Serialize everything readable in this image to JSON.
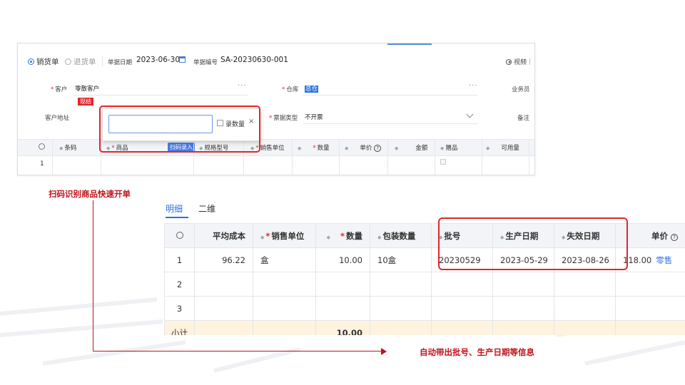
{
  "form": {
    "radio_sales": "销货单",
    "radio_return": "退货单",
    "doc_date_label": "单据日期",
    "doc_date": "2023-06-30",
    "doc_no_label": "单据编号",
    "doc_no": "SA-20230630-001",
    "video_label": "视频",
    "customer_label": "客户",
    "customer_value": "零散客户",
    "cash_tag": "现结",
    "warehouse_label": "仓库",
    "warehouse_value": "总仓",
    "salesperson_label": "业务员",
    "address_label": "客户地址",
    "invoice_label": "票据类型",
    "invoice_value": "不开票",
    "remark_label": "备注"
  },
  "popup": {
    "qty_checkbox_label": "录数量",
    "close": "×"
  },
  "grid_top": {
    "headers": [
      "条码",
      "商品",
      "规格型号",
      "销售单位",
      "数量",
      "单价",
      "金额",
      "赠品",
      "可用量"
    ],
    "scan_button": "扫码录入",
    "row_index": "1"
  },
  "annotations": {
    "scan_caption": "扫码识别商品快速开单",
    "auto_caption": "自动带出批号、生产日期等信息"
  },
  "detail": {
    "tab_detail": "明细",
    "tab_other": "二维",
    "headers": {
      "avg_cost": "平均成本",
      "sales_unit": "销售单位",
      "qty": "数量",
      "pack_qty": "包装数量",
      "batch": "批号",
      "mfg_date": "生产日期",
      "exp_date": "失效日期",
      "price": "单价"
    },
    "rows": [
      {
        "idx": "1",
        "avg_cost": "96.22",
        "unit": "盒",
        "qty": "10.00",
        "pack": "10盒",
        "batch": "20230529",
        "mfg": "2023-05-29",
        "exp": "2023-08-26",
        "price": "118.00",
        "price_tag": "零售"
      },
      {
        "idx": "2"
      },
      {
        "idx": "3"
      }
    ],
    "subtotal_label": "小计",
    "subtotal_qty": "10.00"
  },
  "colors": {
    "accent": "#2f6fde",
    "annotation_red": "#c0131b",
    "highlight_box": "#e0262c"
  }
}
